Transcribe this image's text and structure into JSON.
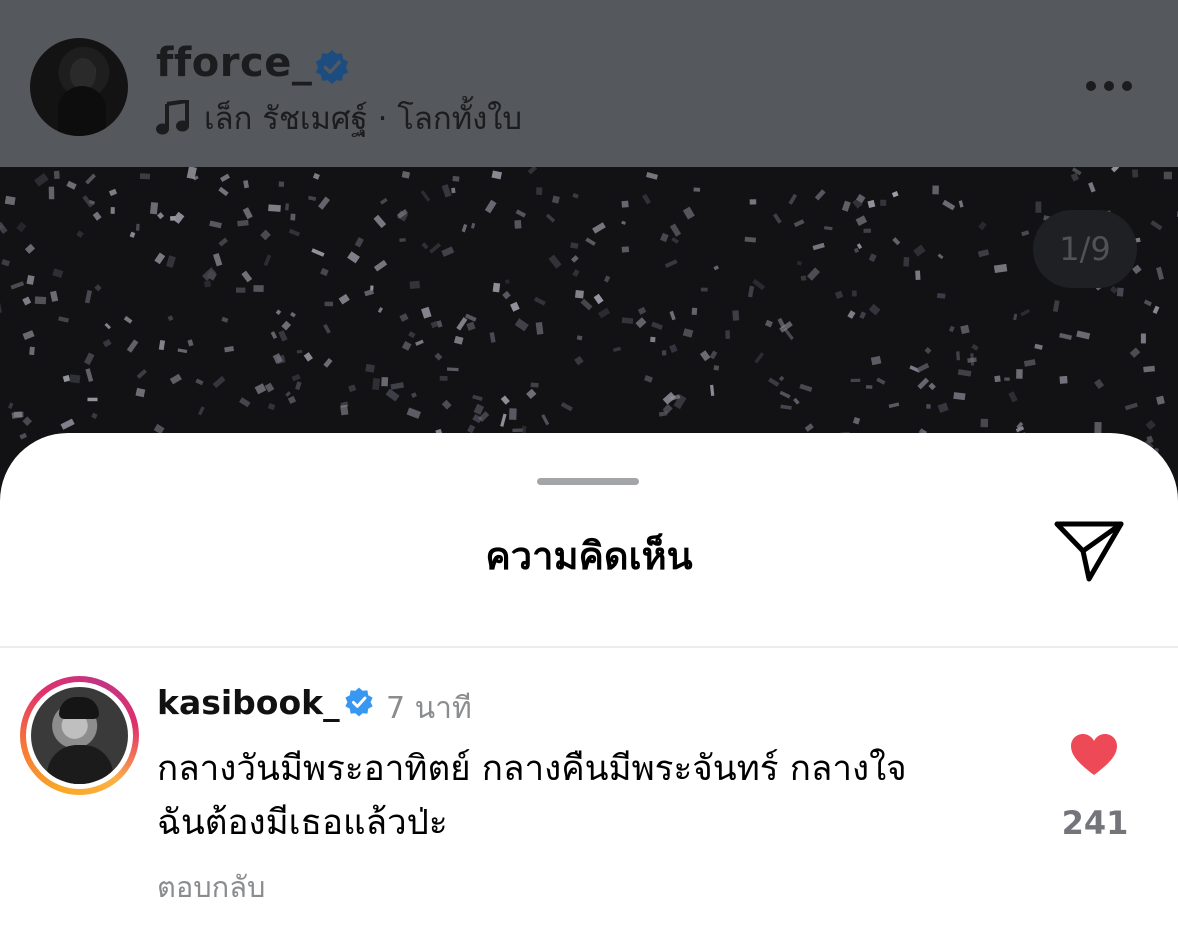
{
  "post": {
    "username": "fforce_",
    "music": "เล็ก รัชเมศฐ์ · โลกทั้งใบ",
    "image_counter": "1/9"
  },
  "sheet": {
    "title": "ความคิดเห็น"
  },
  "comment": {
    "username": "kasibook_",
    "time": "7 นาที",
    "text_line1": "กลางวันมีพระอาทิตย์ กลางคืนมีพระจันทร์ กลางใจ",
    "text_line2": "ฉันต้องมีเธอแล้วป่ะ",
    "reply_label": "ตอบกลับ",
    "likes": "241"
  },
  "icons": {
    "verified": "verified-badge-icon",
    "music": "music-note-icon",
    "more": "more-options-icon",
    "share": "send-icon",
    "like": "heart-icon"
  },
  "colors": {
    "verified": "#3897f0",
    "like": "#ed4956",
    "header_dim": "#55585c"
  }
}
